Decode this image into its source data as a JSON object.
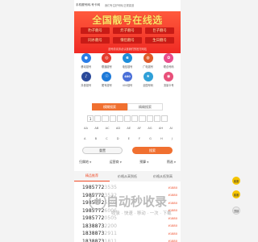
{
  "topbar": {
    "site": "手机靓号网-号卡网",
    "slogan": "我们专注好号码/正规渠道"
  },
  "banner": {
    "title": "全国靓号在线选",
    "tags": [
      "豹子靓号",
      "炸子靓号",
      "巨子靓号",
      "同水靓号",
      "情侣靓号",
      "生日靓号"
    ],
    "note": "选号前请务必认准我们的官方网站"
  },
  "operators": [
    {
      "label": "移动靓号",
      "color": "#2a7ee8",
      "glyph": "●"
    },
    {
      "label": "联通靓号",
      "color": "#e63b2e",
      "glyph": "◎"
    },
    {
      "label": "电信靓号",
      "color": "#1e8edb",
      "glyph": "e"
    },
    {
      "label": "广电靓号",
      "color": "#e05a2a",
      "glyph": "◍"
    },
    {
      "label": "联合号码",
      "color": "#e94c8a",
      "glyph": "✿"
    },
    {
      "label": "抖音靓号",
      "color": "#2b4a9a",
      "glyph": "♪"
    },
    {
      "label": "尾号靓号",
      "color": "#1d7ad9",
      "glyph": "☉"
    },
    {
      "label": "400靓号",
      "color": "#4a6fd8",
      "glyph": "400"
    },
    {
      "label": "全国号码",
      "color": "#2fa0d8",
      "glyph": "★"
    },
    {
      "label": "流量卡号",
      "color": "#e8507a",
      "glyph": "◉"
    }
  ],
  "search": {
    "tab_active": "模糊搜索",
    "tab_inactive": "精确搜索",
    "digits": [
      "1",
      "",
      "",
      "",
      "",
      "",
      "",
      "",
      "",
      "",
      ""
    ],
    "row1": [
      "AA",
      "AB",
      "AC",
      "AD",
      "AE",
      "AF",
      "AG",
      "AH",
      "AI"
    ],
    "row2": [
      "A",
      "B",
      "C",
      "D",
      "E",
      "F",
      "G",
      "H",
      "J"
    ],
    "reset": "重置",
    "submit": "搜索"
  },
  "filters": [
    {
      "label": "归属地"
    },
    {
      "label": "运营商"
    },
    {
      "label": "预算"
    },
    {
      "label": "筛选"
    }
  ],
  "result_tabs": [
    "精品推荐",
    "价格从高到低",
    "价格从低到高"
  ],
  "numbers": [
    {
      "head": "1985772",
      "tail": "3535",
      "price": "¥1880"
    },
    {
      "head": "1985772",
      "tail": "3532",
      "price": "¥1880"
    },
    {
      "head": "1985772",
      "tail": "5505",
      "price": "¥1880"
    },
    {
      "head": "1985772",
      "tail": "6006",
      "price": "¥1880"
    },
    {
      "head": "1985772",
      "tail": "0505",
      "price": "¥1880"
    },
    {
      "head": "1838873",
      "tail": "2200",
      "price": "¥1880"
    },
    {
      "head": "1838873",
      "tail": "2911",
      "price": "¥1880"
    },
    {
      "head": "1838873",
      "tail": "1811",
      "price": "¥1880"
    }
  ],
  "watermark": {
    "title": "自动秒收录",
    "sub": "收录 · 快速 · 移动 · 一次 · 下载"
  },
  "side_buttons": [
    "客服",
    "客服",
    "顶部"
  ]
}
